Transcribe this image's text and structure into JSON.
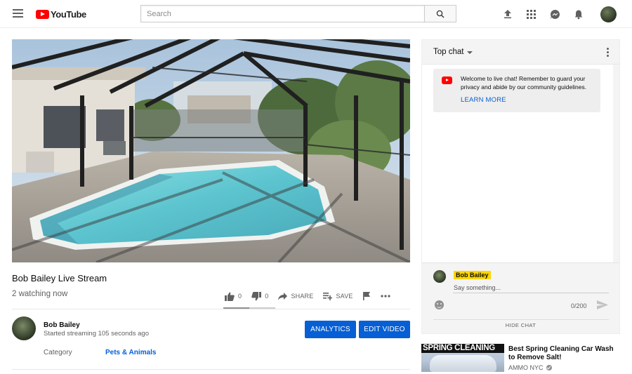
{
  "masthead": {
    "logo_text": "YouTube",
    "search_placeholder": "Search"
  },
  "video": {
    "title": "Bob Bailey Live Stream",
    "views": "2 watching now",
    "likes": "0",
    "dislikes": "0",
    "share_label": "SHARE",
    "save_label": "SAVE"
  },
  "owner": {
    "name": "Bob Bailey",
    "status": "Started streaming 105 seconds ago",
    "analytics_label": "ANALYTICS",
    "edit_label": "EDIT VIDEO"
  },
  "metadata": {
    "category_label": "Category",
    "category_value": "Pets & Animals"
  },
  "chat": {
    "mode": "Top chat",
    "welcome_message": "Welcome to live chat! Remember to guard your privacy and abide by our community guidelines.",
    "learn_more": "LEARN MORE",
    "author_name": "Bob Bailey",
    "input_placeholder": "Say something...",
    "char_count": "0/200",
    "hide_chat": "HIDE CHAT"
  },
  "recommendation": {
    "thumb_text": "SPRING CLEANING",
    "title": "Best Spring Cleaning Car Wash to Remove Salt!",
    "channel": "AMMO NYC"
  },
  "colors": {
    "brand_red": "#ff0000",
    "link_blue": "#065fd4",
    "author_highlight": "#ffd600"
  }
}
